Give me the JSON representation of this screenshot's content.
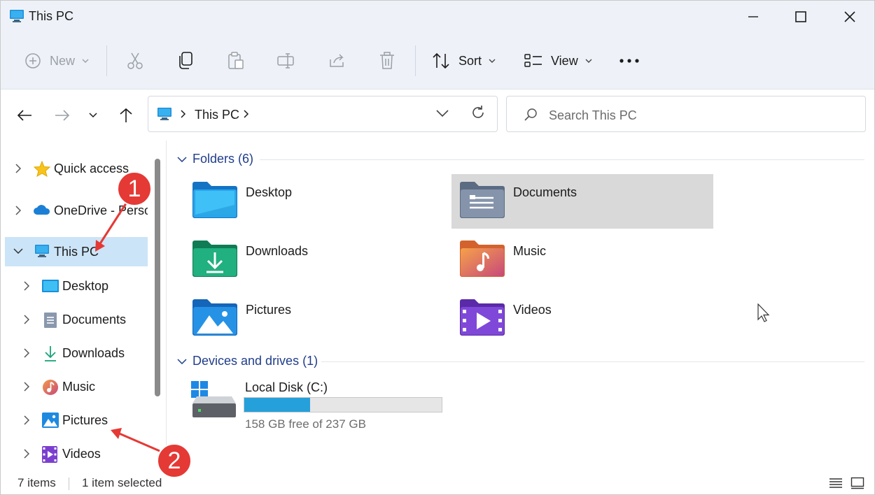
{
  "window": {
    "title": "This PC"
  },
  "toolbar": {
    "new_label": "New",
    "sort_label": "Sort",
    "view_label": "View"
  },
  "address": {
    "crumb": "This PC"
  },
  "search": {
    "placeholder": "Search This PC"
  },
  "sidebar": {
    "items": [
      {
        "label": "Quick access",
        "icon": "star-icon"
      },
      {
        "label": "OneDrive - Perso",
        "icon": "cloud-icon"
      },
      {
        "label": "This PC",
        "icon": "monitor-icon",
        "selected": true
      },
      {
        "label": "Desktop",
        "icon": "desktop-icon"
      },
      {
        "label": "Documents",
        "icon": "documents-icon"
      },
      {
        "label": "Downloads",
        "icon": "download-icon"
      },
      {
        "label": "Music",
        "icon": "music-icon"
      },
      {
        "label": "Pictures",
        "icon": "pictures-icon"
      },
      {
        "label": "Videos",
        "icon": "videos-icon"
      }
    ]
  },
  "content": {
    "folders_header": "Folders (6)",
    "folders": [
      {
        "label": "Desktop",
        "icon": "folder-desktop-icon"
      },
      {
        "label": "Documents",
        "icon": "folder-documents-icon",
        "selected": true
      },
      {
        "label": "Downloads",
        "icon": "folder-downloads-icon"
      },
      {
        "label": "Music",
        "icon": "folder-music-icon"
      },
      {
        "label": "Pictures",
        "icon": "folder-pictures-icon"
      },
      {
        "label": "Videos",
        "icon": "folder-videos-icon"
      }
    ],
    "drives_header": "Devices and drives (1)",
    "drive": {
      "label": "Local Disk (C:)",
      "free_text": "158 GB free of 237 GB",
      "used_fraction": 0.333
    }
  },
  "status": {
    "items_count": "7 items",
    "selected_text": "1 item selected"
  },
  "annotations": {
    "marker1": "1",
    "marker2": "2"
  },
  "colors": {
    "accent": "#26a0da",
    "selection": "#cce4f7",
    "marker": "#e53935"
  }
}
